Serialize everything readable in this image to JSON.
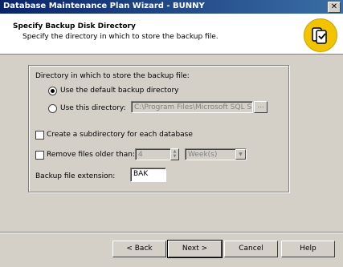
{
  "window": {
    "title": "Database Maintenance Plan Wizard - BUNNY",
    "close_glyph": "✕"
  },
  "header": {
    "title": "Specify Backup Disk Directory",
    "subtitle": "Specify the directory in which to store the backup file."
  },
  "form": {
    "group_label": "Directory in which to store the backup file:",
    "radio_default_label": "Use the default backup directory",
    "radio_custom_label": "Use this directory:",
    "directory_path": "C:\\Program Files\\Microsoft SQL Se",
    "browse_label": "...",
    "subdir_label": "Create a subdirectory for each database",
    "remove_label": "Remove files older than:",
    "remove_count": "4",
    "remove_unit": "Week(s)",
    "extension_label": "Backup file extension:",
    "extension_value": "BAK"
  },
  "buttons": {
    "back": "< Back",
    "next": "Next >",
    "cancel": "Cancel",
    "help": "Help"
  },
  "colors": {
    "titlebar": "#0a246a",
    "icon_bg": "#f2c400",
    "face": "#d4d0c8"
  }
}
